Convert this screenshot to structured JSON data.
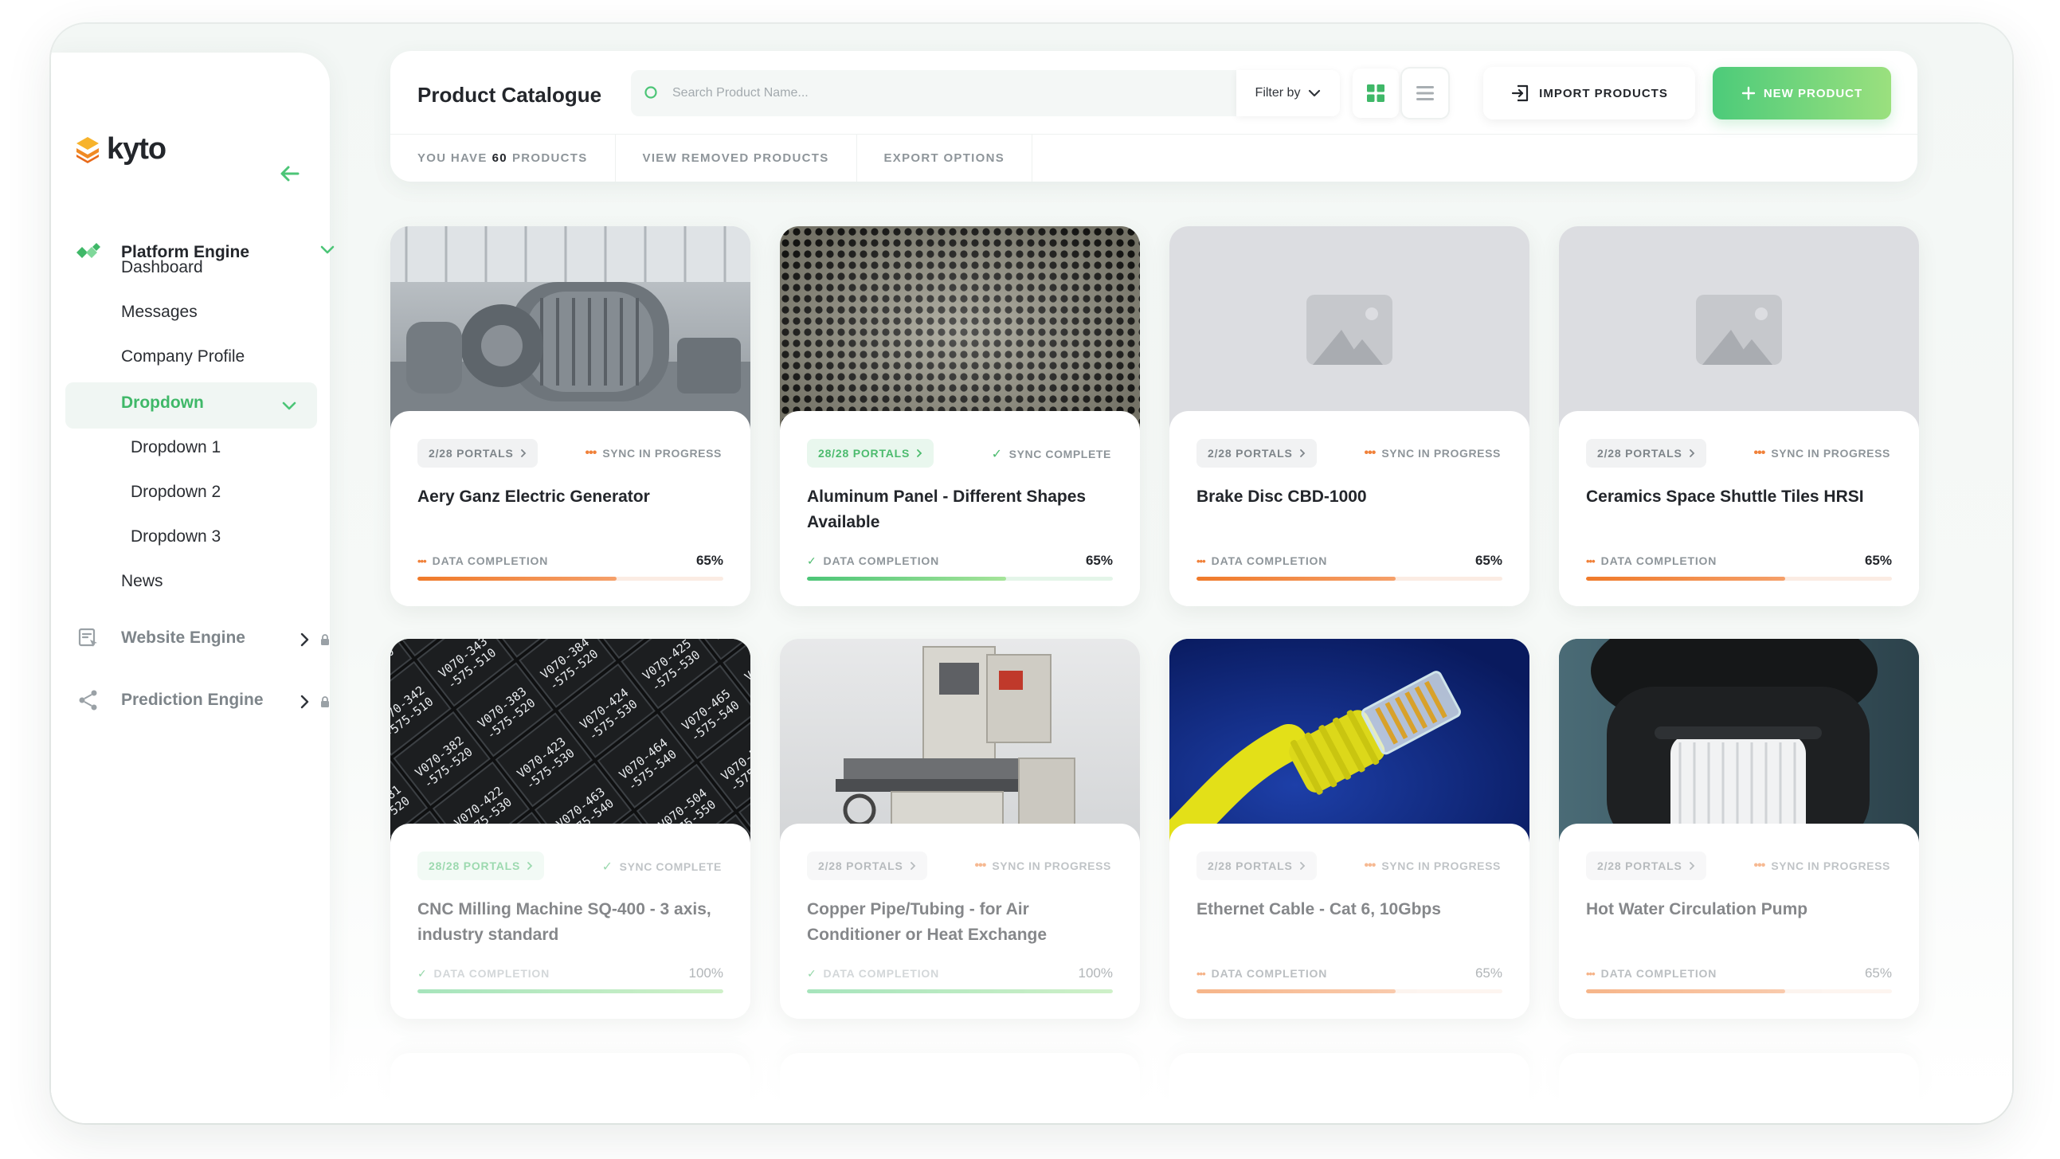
{
  "brand": {
    "name": "kyto",
    "accent": "#4cc577",
    "logo_orange": "#f08a24"
  },
  "sidebar": {
    "sections": [
      {
        "label": "Platform Engine",
        "color": "#23262b",
        "locked": false,
        "expanded": true
      },
      {
        "label": "Website Engine",
        "color": "#7e858a",
        "locked": true,
        "expanded": false
      },
      {
        "label": "Prediction Engine",
        "color": "#7e858a",
        "locked": true,
        "expanded": false
      }
    ],
    "items": [
      "Dashboard",
      "Messages",
      "Company Profile"
    ],
    "active_item": "Dropdown",
    "sub_items": [
      "Dropdown 1",
      "Dropdown 2",
      "Dropdown 3"
    ],
    "after_item": "News"
  },
  "header": {
    "title": "Product Catalogue",
    "search_placeholder": "Search Product Name...",
    "filter_label": "Filter by",
    "import_label": "IMPORT PRODUCTS",
    "new_label": "NEW PRODUCT",
    "tabs": {
      "count_prefix": "YOU HAVE",
      "count": "60",
      "count_suffix": "PRODUCTS",
      "removed": "VIEW REMOVED PRODUCTS",
      "export": "EXPORT OPTIONS"
    }
  },
  "products": [
    {
      "title": "Aery Ganz Electric Generator",
      "portals": "2/28 PORTALS",
      "portals_state": "gray",
      "sync": "SYNC IN PROGRESS",
      "sync_state": "progress",
      "completion_label": "DATA COMPLETION",
      "completion": "65%",
      "completion_value": 0.65,
      "image": "generator"
    },
    {
      "title": "Aluminum Panel - Different Shapes Available",
      "portals": "28/28 PORTALS",
      "portals_state": "green",
      "sync": "SYNC COMPLETE",
      "sync_state": "complete",
      "completion_label": "DATA COMPLETION",
      "completion": "65%",
      "completion_value": 0.65,
      "image": "perforated-metal"
    },
    {
      "title": "Brake Disc CBD-1000",
      "portals": "2/28 PORTALS",
      "portals_state": "gray",
      "sync": "SYNC IN PROGRESS",
      "sync_state": "progress",
      "completion_label": "DATA COMPLETION",
      "completion": "65%",
      "completion_value": 0.65,
      "image": "placeholder"
    },
    {
      "title": "Ceramics Space Shuttle Tiles HRSI",
      "portals": "2/28 PORTALS",
      "portals_state": "gray",
      "sync": "SYNC IN PROGRESS",
      "sync_state": "progress",
      "completion_label": "DATA COMPLETION",
      "completion": "65%",
      "completion_value": 0.65,
      "image": "placeholder"
    },
    {
      "title": "CNC Milling Machine SQ-400 - 3 axis, industry standard",
      "portals": "28/28 PORTALS",
      "portals_state": "green",
      "sync": "SYNC COMPLETE",
      "sync_state": "complete",
      "completion_label": "DATA COMPLETION",
      "completion": "100%",
      "completion_value": 1.0,
      "image": "tiles"
    },
    {
      "title": "Copper Pipe/Tubing - for Air Conditioner or Heat Exchange",
      "portals": "2/28 PORTALS",
      "portals_state": "gray",
      "sync": "SYNC IN PROGRESS",
      "sync_state": "progress",
      "completion_label": "DATA COMPLETION",
      "completion": "100%",
      "completion_value": 1.0,
      "image": "milling"
    },
    {
      "title": "Ethernet Cable - Cat 6, 10Gbps",
      "portals": "2/28 PORTALS",
      "portals_state": "gray",
      "sync": "SYNC IN PROGRESS",
      "sync_state": "progress",
      "completion_label": "DATA COMPLETION",
      "completion": "65%",
      "completion_value": 0.65,
      "image": "ethernet"
    },
    {
      "title": "Hot Water Circulation Pump",
      "portals": "2/28 PORTALS",
      "portals_state": "gray",
      "sync": "SYNC IN PROGRESS",
      "sync_state": "progress",
      "completion_label": "DATA COMPLETION",
      "completion": "65%",
      "completion_value": 0.65,
      "image": "pump"
    }
  ]
}
